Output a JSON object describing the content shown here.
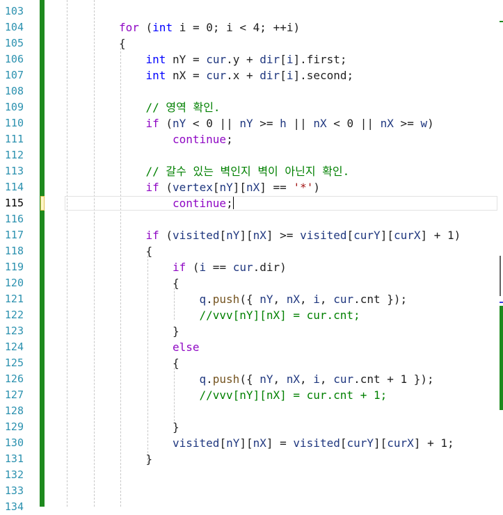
{
  "editor": {
    "line_numbers": [
      "103",
      "104",
      "105",
      "106",
      "107",
      "108",
      "109",
      "110",
      "111",
      "112",
      "113",
      "114",
      "115",
      "116",
      "117",
      "118",
      "119",
      "120",
      "121",
      "122",
      "123",
      "124",
      "125",
      "126",
      "127",
      "128",
      "129",
      "130",
      "131",
      "132",
      "133",
      "134"
    ],
    "current_line": "115",
    "code_lines": [
      {
        "indent": 0,
        "tokens": []
      },
      {
        "indent": 3,
        "tokens": [
          {
            "t": "for",
            "c": "ctl"
          },
          {
            "t": " (",
            "c": ""
          },
          {
            "t": "int",
            "c": "kw"
          },
          {
            "t": " i = 0; i < 4; ++i)",
            "c": ""
          }
        ]
      },
      {
        "indent": 3,
        "tokens": [
          {
            "t": "{",
            "c": ""
          }
        ]
      },
      {
        "indent": 4,
        "tokens": [
          {
            "t": "int",
            "c": "kw"
          },
          {
            "t": " nY = ",
            "c": ""
          },
          {
            "t": "cur",
            "c": "var"
          },
          {
            "t": ".y + ",
            "c": ""
          },
          {
            "t": "dir",
            "c": "var"
          },
          {
            "t": "[",
            "c": ""
          },
          {
            "t": "i",
            "c": "var"
          },
          {
            "t": "].first;",
            "c": ""
          }
        ]
      },
      {
        "indent": 4,
        "tokens": [
          {
            "t": "int",
            "c": "kw"
          },
          {
            "t": " nX = ",
            "c": ""
          },
          {
            "t": "cur",
            "c": "var"
          },
          {
            "t": ".x + ",
            "c": ""
          },
          {
            "t": "dir",
            "c": "var"
          },
          {
            "t": "[",
            "c": ""
          },
          {
            "t": "i",
            "c": "var"
          },
          {
            "t": "].second;",
            "c": ""
          }
        ]
      },
      {
        "indent": 0,
        "tokens": []
      },
      {
        "indent": 4,
        "tokens": [
          {
            "t": "// 영역 확인.",
            "c": "cmt"
          }
        ]
      },
      {
        "indent": 4,
        "tokens": [
          {
            "t": "if",
            "c": "ctl"
          },
          {
            "t": " (",
            "c": ""
          },
          {
            "t": "nY",
            "c": "var"
          },
          {
            "t": " < 0 || ",
            "c": ""
          },
          {
            "t": "nY",
            "c": "var"
          },
          {
            "t": " >= ",
            "c": ""
          },
          {
            "t": "h",
            "c": "var"
          },
          {
            "t": " || ",
            "c": ""
          },
          {
            "t": "nX",
            "c": "var"
          },
          {
            "t": " < 0 || ",
            "c": ""
          },
          {
            "t": "nX",
            "c": "var"
          },
          {
            "t": " >= ",
            "c": ""
          },
          {
            "t": "w",
            "c": "var"
          },
          {
            "t": ")",
            "c": ""
          }
        ]
      },
      {
        "indent": 5,
        "tokens": [
          {
            "t": "continue",
            "c": "ctl"
          },
          {
            "t": ";",
            "c": ""
          }
        ]
      },
      {
        "indent": 0,
        "tokens": []
      },
      {
        "indent": 4,
        "tokens": [
          {
            "t": "// 갈수 있는 벽인지 벽이 아닌지 확인.",
            "c": "cmt"
          }
        ]
      },
      {
        "indent": 4,
        "tokens": [
          {
            "t": "if",
            "c": "ctl"
          },
          {
            "t": " (",
            "c": ""
          },
          {
            "t": "vertex",
            "c": "var"
          },
          {
            "t": "[",
            "c": ""
          },
          {
            "t": "nY",
            "c": "var"
          },
          {
            "t": "][",
            "c": ""
          },
          {
            "t": "nX",
            "c": "var"
          },
          {
            "t": "] == ",
            "c": ""
          },
          {
            "t": "'*'",
            "c": "str"
          },
          {
            "t": ")",
            "c": ""
          }
        ]
      },
      {
        "indent": 5,
        "tokens": [
          {
            "t": "continue",
            "c": "ctl"
          },
          {
            "t": ";",
            "c": ""
          }
        ],
        "caret": true
      },
      {
        "indent": 0,
        "tokens": []
      },
      {
        "indent": 4,
        "tokens": [
          {
            "t": "if",
            "c": "ctl"
          },
          {
            "t": " (",
            "c": ""
          },
          {
            "t": "visited",
            "c": "var"
          },
          {
            "t": "[",
            "c": ""
          },
          {
            "t": "nY",
            "c": "var"
          },
          {
            "t": "][",
            "c": ""
          },
          {
            "t": "nX",
            "c": "var"
          },
          {
            "t": "] >= ",
            "c": ""
          },
          {
            "t": "visited",
            "c": "var"
          },
          {
            "t": "[",
            "c": ""
          },
          {
            "t": "curY",
            "c": "var"
          },
          {
            "t": "][",
            "c": ""
          },
          {
            "t": "curX",
            "c": "var"
          },
          {
            "t": "] + 1)",
            "c": ""
          }
        ]
      },
      {
        "indent": 4,
        "tokens": [
          {
            "t": "{",
            "c": ""
          }
        ]
      },
      {
        "indent": 5,
        "tokens": [
          {
            "t": "if",
            "c": "ctl"
          },
          {
            "t": " (",
            "c": ""
          },
          {
            "t": "i",
            "c": "var"
          },
          {
            "t": " == ",
            "c": ""
          },
          {
            "t": "cur",
            "c": "var"
          },
          {
            "t": ".dir)",
            "c": ""
          }
        ]
      },
      {
        "indent": 5,
        "tokens": [
          {
            "t": "{",
            "c": ""
          }
        ]
      },
      {
        "indent": 6,
        "tokens": [
          {
            "t": "q",
            "c": "var"
          },
          {
            "t": ".",
            "c": ""
          },
          {
            "t": "push",
            "c": "fn"
          },
          {
            "t": "({ ",
            "c": ""
          },
          {
            "t": "nY",
            "c": "var"
          },
          {
            "t": ", ",
            "c": ""
          },
          {
            "t": "nX",
            "c": "var"
          },
          {
            "t": ", ",
            "c": ""
          },
          {
            "t": "i",
            "c": "var"
          },
          {
            "t": ", ",
            "c": ""
          },
          {
            "t": "cur",
            "c": "var"
          },
          {
            "t": ".cnt });",
            "c": ""
          }
        ]
      },
      {
        "indent": 6,
        "tokens": [
          {
            "t": "//vvv[nY][nX] = cur.cnt;",
            "c": "cmt"
          }
        ]
      },
      {
        "indent": 5,
        "tokens": [
          {
            "t": "}",
            "c": ""
          }
        ]
      },
      {
        "indent": 5,
        "tokens": [
          {
            "t": "else",
            "c": "ctl"
          }
        ]
      },
      {
        "indent": 5,
        "tokens": [
          {
            "t": "{",
            "c": ""
          }
        ]
      },
      {
        "indent": 6,
        "tokens": [
          {
            "t": "q",
            "c": "var"
          },
          {
            "t": ".",
            "c": ""
          },
          {
            "t": "push",
            "c": "fn"
          },
          {
            "t": "({ ",
            "c": ""
          },
          {
            "t": "nY",
            "c": "var"
          },
          {
            "t": ", ",
            "c": ""
          },
          {
            "t": "nX",
            "c": "var"
          },
          {
            "t": ", ",
            "c": ""
          },
          {
            "t": "i",
            "c": "var"
          },
          {
            "t": ", ",
            "c": ""
          },
          {
            "t": "cur",
            "c": "var"
          },
          {
            "t": ".cnt + 1 });",
            "c": ""
          }
        ]
      },
      {
        "indent": 6,
        "tokens": [
          {
            "t": "//vvv[nY][nX] = cur.cnt + 1;",
            "c": "cmt"
          }
        ]
      },
      {
        "indent": 0,
        "tokens": []
      },
      {
        "indent": 5,
        "tokens": [
          {
            "t": "}",
            "c": ""
          }
        ]
      },
      {
        "indent": 5,
        "tokens": [
          {
            "t": "visited",
            "c": "var"
          },
          {
            "t": "[",
            "c": ""
          },
          {
            "t": "nY",
            "c": "var"
          },
          {
            "t": "][",
            "c": ""
          },
          {
            "t": "nX",
            "c": "var"
          },
          {
            "t": "] = ",
            "c": ""
          },
          {
            "t": "visited",
            "c": "var"
          },
          {
            "t": "[",
            "c": ""
          },
          {
            "t": "curY",
            "c": "var"
          },
          {
            "t": "][",
            "c": ""
          },
          {
            "t": "curX",
            "c": "var"
          },
          {
            "t": "] + 1;",
            "c": ""
          }
        ]
      },
      {
        "indent": 4,
        "tokens": [
          {
            "t": "}",
            "c": ""
          }
        ]
      },
      {
        "indent": 0,
        "tokens": []
      },
      {
        "indent": 0,
        "tokens": []
      },
      {
        "indent": 0,
        "tokens": []
      }
    ],
    "colors": {
      "line_number": "#2b91af",
      "keyword": "#0000ff",
      "control_keyword": "#8f08c4",
      "variable": "#1f377f",
      "function": "#74531f",
      "string": "#a31515",
      "comment": "#008000",
      "change_bar": "#1e8a1e"
    }
  }
}
